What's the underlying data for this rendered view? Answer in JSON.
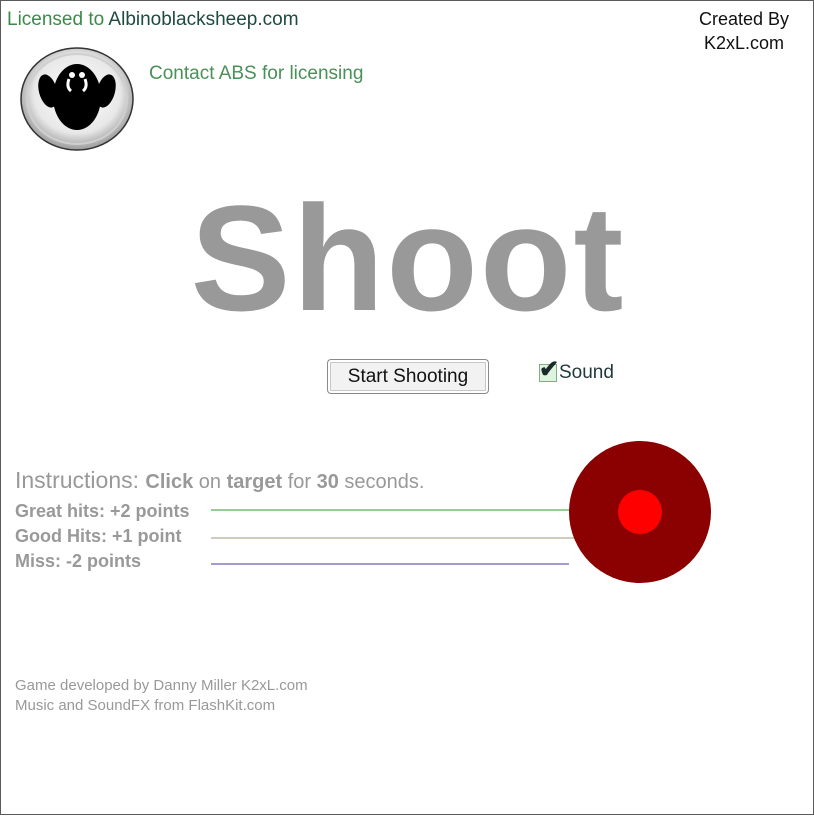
{
  "license": {
    "prefix": "Licensed to ",
    "site": "Albinoblacksheep.com"
  },
  "creator": {
    "line1": "Created By",
    "line2": "K2xL.com"
  },
  "contact_text": "Contact ABS for licensing",
  "game_title": "Shoot",
  "start_button_label": "Start Shooting",
  "sound": {
    "label": "Sound",
    "checked": true,
    "check_glyph": "✔"
  },
  "instructions": {
    "lead": "Instructions: ",
    "w1": "Click",
    "w2": " on ",
    "w3": "target",
    "w4": " for ",
    "w5": "30",
    "w6": " seconds."
  },
  "scoring": {
    "great": "Great hits: +2 points",
    "good": "Good Hits: +1 point",
    "miss": "Miss: -2 points"
  },
  "credits": {
    "line1": "Game developed by Danny Miller K2xL.com",
    "line2": "Music and SoundFX from FlashKit.com"
  },
  "colors": {
    "target_outer": "#8b0000",
    "target_inner": "#ff0000",
    "great_line": "#2e9a2e",
    "good_line": "#a09a7a",
    "miss_line": "#4a3aa0"
  },
  "icons": {
    "logo": "sheep-logo-icon",
    "target": "target-icon"
  }
}
